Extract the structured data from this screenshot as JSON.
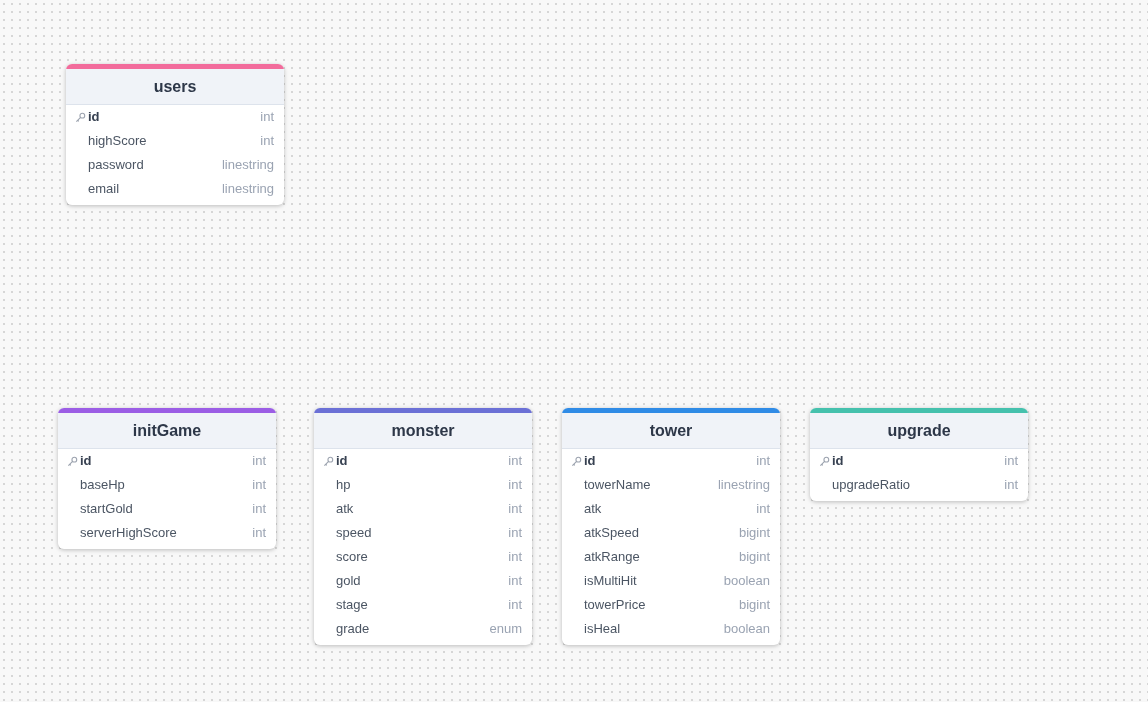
{
  "tables": [
    {
      "name": "users",
      "color": "#f26b9b",
      "fields": [
        {
          "name": "id",
          "type": "int",
          "primary_key": true
        },
        {
          "name": "highScore",
          "type": "int",
          "primary_key": false
        },
        {
          "name": "password",
          "type": "linestring",
          "primary_key": false
        },
        {
          "name": "email",
          "type": "linestring",
          "primary_key": false
        }
      ]
    },
    {
      "name": "initGame",
      "color": "#9b5de5",
      "fields": [
        {
          "name": "id",
          "type": "int",
          "primary_key": true
        },
        {
          "name": "baseHp",
          "type": "int",
          "primary_key": false
        },
        {
          "name": "startGold",
          "type": "int",
          "primary_key": false
        },
        {
          "name": "serverHighScore",
          "type": "int",
          "primary_key": false
        }
      ]
    },
    {
      "name": "monster",
      "color": "#6b70d6",
      "fields": [
        {
          "name": "id",
          "type": "int",
          "primary_key": true
        },
        {
          "name": "hp",
          "type": "int",
          "primary_key": false
        },
        {
          "name": "atk",
          "type": "int",
          "primary_key": false
        },
        {
          "name": "speed",
          "type": "int",
          "primary_key": false
        },
        {
          "name": "score",
          "type": "int",
          "primary_key": false
        },
        {
          "name": "gold",
          "type": "int",
          "primary_key": false
        },
        {
          "name": "stage",
          "type": "int",
          "primary_key": false
        },
        {
          "name": "grade",
          "type": "enum",
          "primary_key": false
        }
      ]
    },
    {
      "name": "tower",
      "color": "#2f8be6",
      "fields": [
        {
          "name": "id",
          "type": "int",
          "primary_key": true
        },
        {
          "name": "towerName",
          "type": "linestring",
          "primary_key": false
        },
        {
          "name": "atk",
          "type": "int",
          "primary_key": false
        },
        {
          "name": "atkSpeed",
          "type": "bigint",
          "primary_key": false
        },
        {
          "name": "atkRange",
          "type": "bigint",
          "primary_key": false
        },
        {
          "name": "isMultiHit",
          "type": "boolean",
          "primary_key": false
        },
        {
          "name": "towerPrice",
          "type": "bigint",
          "primary_key": false
        },
        {
          "name": "isHeal",
          "type": "boolean",
          "primary_key": false
        }
      ]
    },
    {
      "name": "upgrade",
      "color": "#45c1ad",
      "fields": [
        {
          "name": "id",
          "type": "int",
          "primary_key": true
        },
        {
          "name": "upgradeRatio",
          "type": "int",
          "primary_key": false
        }
      ]
    }
  ]
}
